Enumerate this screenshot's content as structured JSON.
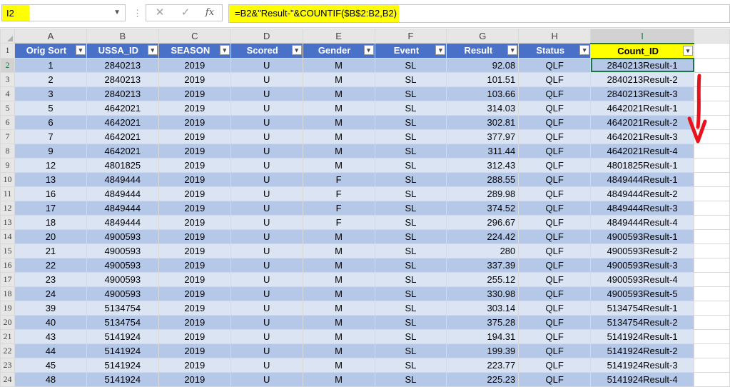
{
  "formula_bar": {
    "name_box": "I2",
    "cancel_glyph": "✕",
    "enter_glyph": "✓",
    "fx_label": "fx",
    "formula": "=B2&\"Result-\"&COUNTIF($B$2:B2,B2)"
  },
  "columns": [
    "A",
    "B",
    "C",
    "D",
    "E",
    "F",
    "G",
    "H",
    "I"
  ],
  "headers": [
    "Orig Sort",
    "USSA_ID",
    "SEASON",
    "Scored",
    "Gender",
    "Event",
    "Result",
    "Status",
    "Count_ID"
  ],
  "filter_glyph": "▾",
  "rows": [
    {
      "n": "2",
      "cells": [
        "1",
        "2840213",
        "2019",
        "U",
        "M",
        "SL",
        "92.08",
        "QLF",
        "2840213Result-1"
      ]
    },
    {
      "n": "3",
      "cells": [
        "2",
        "2840213",
        "2019",
        "U",
        "M",
        "SL",
        "101.51",
        "QLF",
        "2840213Result-2"
      ]
    },
    {
      "n": "4",
      "cells": [
        "3",
        "2840213",
        "2019",
        "U",
        "M",
        "SL",
        "103.66",
        "QLF",
        "2840213Result-3"
      ]
    },
    {
      "n": "5",
      "cells": [
        "5",
        "4642021",
        "2019",
        "U",
        "M",
        "SL",
        "314.03",
        "QLF",
        "4642021Result-1"
      ]
    },
    {
      "n": "6",
      "cells": [
        "6",
        "4642021",
        "2019",
        "U",
        "M",
        "SL",
        "302.81",
        "QLF",
        "4642021Result-2"
      ]
    },
    {
      "n": "7",
      "cells": [
        "7",
        "4642021",
        "2019",
        "U",
        "M",
        "SL",
        "377.97",
        "QLF",
        "4642021Result-3"
      ]
    },
    {
      "n": "8",
      "cells": [
        "9",
        "4642021",
        "2019",
        "U",
        "M",
        "SL",
        "311.44",
        "QLF",
        "4642021Result-4"
      ]
    },
    {
      "n": "9",
      "cells": [
        "12",
        "4801825",
        "2019",
        "U",
        "M",
        "SL",
        "312.43",
        "QLF",
        "4801825Result-1"
      ]
    },
    {
      "n": "10",
      "cells": [
        "13",
        "4849444",
        "2019",
        "U",
        "F",
        "SL",
        "288.55",
        "QLF",
        "4849444Result-1"
      ]
    },
    {
      "n": "11",
      "cells": [
        "16",
        "4849444",
        "2019",
        "U",
        "F",
        "SL",
        "289.98",
        "QLF",
        "4849444Result-2"
      ]
    },
    {
      "n": "12",
      "cells": [
        "17",
        "4849444",
        "2019",
        "U",
        "F",
        "SL",
        "374.52",
        "QLF",
        "4849444Result-3"
      ]
    },
    {
      "n": "13",
      "cells": [
        "18",
        "4849444",
        "2019",
        "U",
        "F",
        "SL",
        "296.67",
        "QLF",
        "4849444Result-4"
      ]
    },
    {
      "n": "14",
      "cells": [
        "20",
        "4900593",
        "2019",
        "U",
        "M",
        "SL",
        "224.42",
        "QLF",
        "4900593Result-1"
      ]
    },
    {
      "n": "15",
      "cells": [
        "21",
        "4900593",
        "2019",
        "U",
        "M",
        "SL",
        "280",
        "QLF",
        "4900593Result-2"
      ]
    },
    {
      "n": "16",
      "cells": [
        "22",
        "4900593",
        "2019",
        "U",
        "M",
        "SL",
        "337.39",
        "QLF",
        "4900593Result-3"
      ]
    },
    {
      "n": "17",
      "cells": [
        "23",
        "4900593",
        "2019",
        "U",
        "M",
        "SL",
        "255.12",
        "QLF",
        "4900593Result-4"
      ]
    },
    {
      "n": "18",
      "cells": [
        "24",
        "4900593",
        "2019",
        "U",
        "M",
        "SL",
        "330.98",
        "QLF",
        "4900593Result-5"
      ]
    },
    {
      "n": "19",
      "cells": [
        "39",
        "5134754",
        "2019",
        "U",
        "M",
        "SL",
        "303.14",
        "QLF",
        "5134754Result-1"
      ]
    },
    {
      "n": "20",
      "cells": [
        "40",
        "5134754",
        "2019",
        "U",
        "M",
        "SL",
        "375.28",
        "QLF",
        "5134754Result-2"
      ]
    },
    {
      "n": "21",
      "cells": [
        "43",
        "5141924",
        "2019",
        "U",
        "M",
        "SL",
        "194.31",
        "QLF",
        "5141924Result-1"
      ]
    },
    {
      "n": "22",
      "cells": [
        "44",
        "5141924",
        "2019",
        "U",
        "M",
        "SL",
        "199.39",
        "QLF",
        "5141924Result-2"
      ]
    },
    {
      "n": "23",
      "cells": [
        "45",
        "5141924",
        "2019",
        "U",
        "M",
        "SL",
        "223.77",
        "QLF",
        "5141924Result-3"
      ]
    },
    {
      "n": "24",
      "cells": [
        "48",
        "5141924",
        "2019",
        "U",
        "M",
        "SL",
        "225.23",
        "QLF",
        "5141924Result-4"
      ]
    }
  ],
  "colors": {
    "header_blue": "#4a71c8",
    "band_dark": "#b6c8e8",
    "band_light": "#dbe4f3",
    "highlight": "#ffff00",
    "arrow": "#e8121c",
    "selection": "#217346"
  }
}
